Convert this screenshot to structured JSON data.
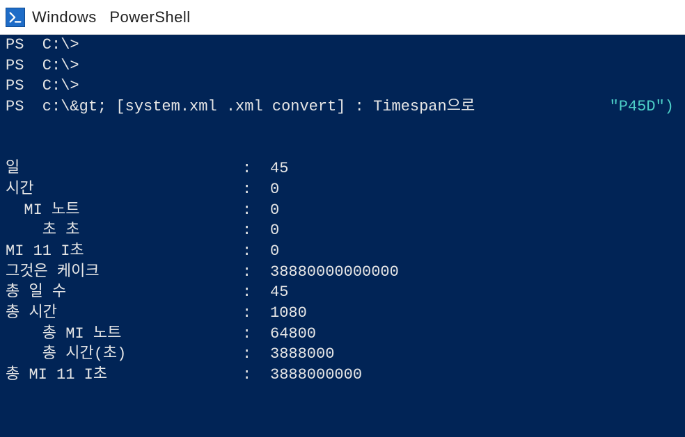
{
  "titlebar": {
    "part1": "Windows",
    "part2": "PowerShell"
  },
  "prompts": {
    "p1": "PS  C:\\>",
    "p2": "PS  C:\\>",
    "p3": "PS  C:\\>",
    "cmd_prefix": "PS  c:\\&gt; [system.xml .xml convert] : Timespan으로",
    "cmd_right": "\"P45D\")"
  },
  "output": [
    {
      "label": "일",
      "value": "45"
    },
    {
      "label": "시간",
      "value": "0"
    },
    {
      "label": "  MI 노트",
      "value": "0"
    },
    {
      "label": "    초 초",
      "value": "0"
    },
    {
      "label": "MI 11 I초",
      "value": "0"
    },
    {
      "label": "그것은 케이크",
      "value": "38880000000000"
    },
    {
      "label": "총 일 수",
      "value": "45"
    },
    {
      "label": "총 시간",
      "value": "1080"
    },
    {
      "label": "    총 MI 노트",
      "value": "64800"
    },
    {
      "label": "    총 시간(초)",
      "value": "3888000"
    },
    {
      "label": "총 MI 11 I초",
      "value": "3888000000"
    }
  ]
}
